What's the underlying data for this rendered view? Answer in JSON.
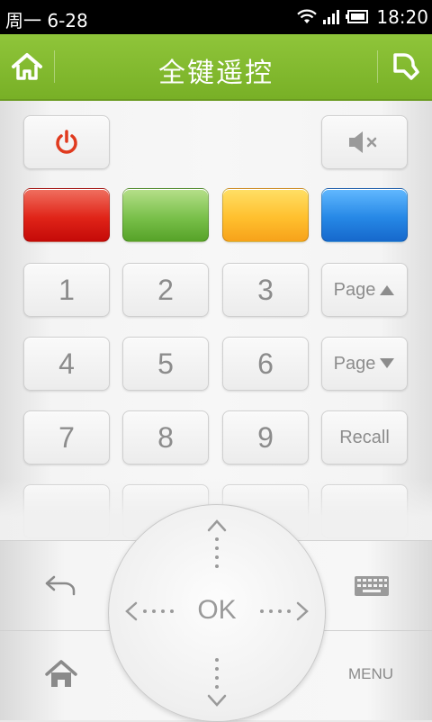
{
  "status_bar": {
    "date": "周一  6-28",
    "time": "18:20"
  },
  "header": {
    "title": "全键遥控"
  },
  "keys": {
    "numbers": [
      "1",
      "2",
      "3",
      "4",
      "5",
      "6",
      "7",
      "8",
      "9"
    ],
    "page_up": "Page",
    "page_down": "Page",
    "recall": "Recall"
  },
  "dpad": {
    "ok": "OK"
  },
  "bottom": {
    "menu": "MENU"
  },
  "colors": {
    "accent": "#7fb82e",
    "red": "#e02418",
    "green": "#79c04a",
    "yellow": "#ffc02e",
    "blue": "#2688e6",
    "power": "#e03a1e"
  }
}
